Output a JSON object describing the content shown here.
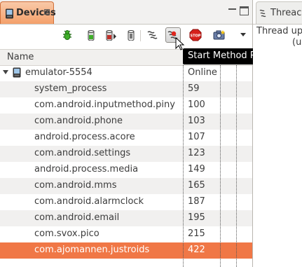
{
  "devices_view": {
    "tab_title": "Devices",
    "column_name": "Name",
    "tooltip": "Start Method Profiling",
    "device": {
      "name": "emulator-5554",
      "status": "Online"
    },
    "processes": [
      {
        "name": "system_process",
        "pid": "59"
      },
      {
        "name": "com.android.inputmethod.piny",
        "pid": "100"
      },
      {
        "name": "com.android.phone",
        "pid": "103"
      },
      {
        "name": "android.process.acore",
        "pid": "107"
      },
      {
        "name": "com.android.settings",
        "pid": "123"
      },
      {
        "name": "android.process.media",
        "pid": "149"
      },
      {
        "name": "com.android.mms",
        "pid": "165"
      },
      {
        "name": "com.android.alarmclock",
        "pid": "187"
      },
      {
        "name": "com.android.email",
        "pid": "195"
      },
      {
        "name": "com.svox.pico",
        "pid": "215"
      },
      {
        "name": "com.ajomannen.justroids",
        "pid": "422",
        "selected": true
      }
    ],
    "toolbar_icons": [
      "debug-bug-icon",
      "update-heap-icon",
      "dump-hprof-icon",
      "cause-gc-icon",
      "update-threads-icon",
      "start-method-profiling-icon",
      "stop-process-icon",
      "screen-capture-icon",
      "view-menu-icon"
    ],
    "colors": {
      "selected_row": "#f07746",
      "active_tab": "#f4a06a"
    }
  },
  "threads_view": {
    "tab_title": "Threac",
    "line1": "Thread up",
    "line2": "(u"
  }
}
